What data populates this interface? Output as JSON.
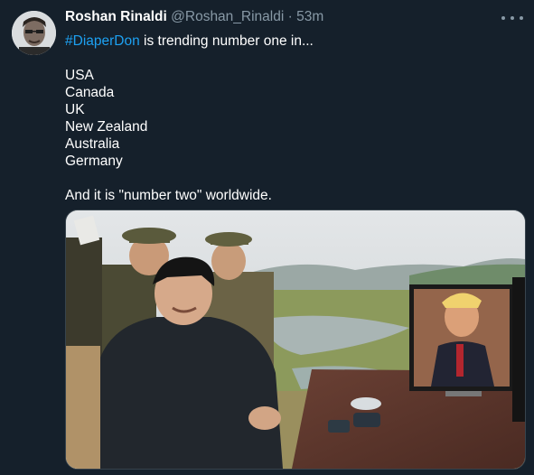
{
  "tweet": {
    "author_name": "Roshan Rinaldi",
    "handle": "@Roshan_Rinaldi",
    "separator": "·",
    "time": "53m",
    "text_lead_hashtag": "#DiaperDon",
    "text_lead_rest": " is trending number one in...",
    "countries": [
      "USA",
      "Canada",
      "UK",
      "New Zealand",
      "Australia",
      "Germany"
    ],
    "closing": "And it is \"number two\" worldwide."
  },
  "icons": {
    "more": "more-horizontal-icon"
  },
  "colors": {
    "background": "#15202b",
    "link": "#1da1f2",
    "secondary": "#8899a6"
  }
}
